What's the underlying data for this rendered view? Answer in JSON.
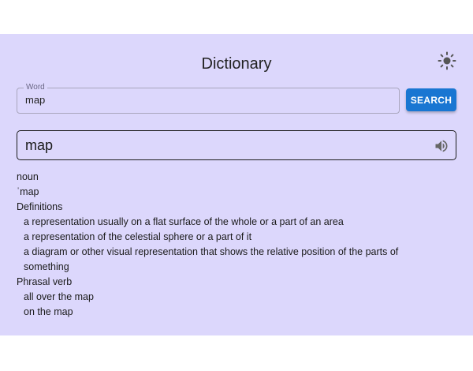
{
  "header": {
    "title": "Dictionary",
    "theme_icon": "sun-icon"
  },
  "search": {
    "label": "Word",
    "value": "map",
    "button_label": "SEARCH"
  },
  "result": {
    "word": "map",
    "audio_icon": "speaker-icon",
    "part_of_speech": "noun",
    "phonetic": "ˈmap",
    "definitions_heading": "Definitions",
    "definitions": [
      "a representation usually on a flat surface of the whole or a part of an area",
      "a representation of the celestial sphere or a part of it",
      "a diagram or other visual representation that shows the relative position of the parts of something"
    ],
    "phrasal_heading": "Phrasal verb",
    "phrasal_verbs": [
      "all over the map",
      "on the map"
    ]
  },
  "colors": {
    "background": "#dcd7fc",
    "accent": "#1976d2"
  }
}
